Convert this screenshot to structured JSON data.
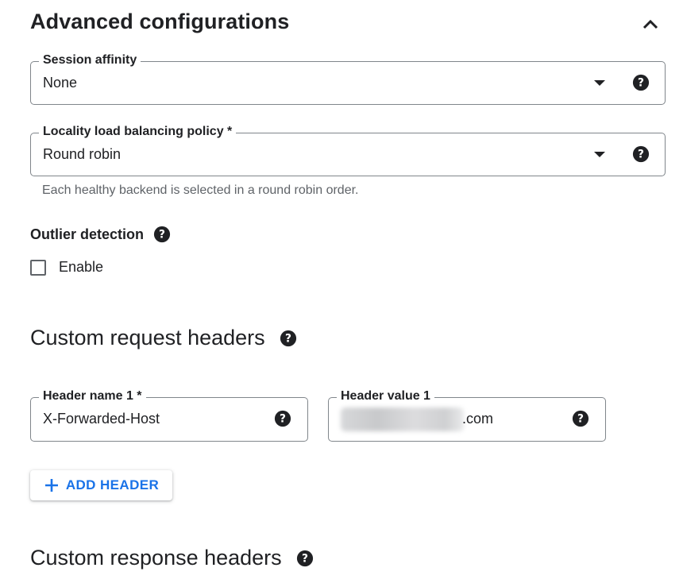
{
  "advanced": {
    "title": "Advanced configurations",
    "collapse_icon": "chevron-up-icon"
  },
  "session_affinity": {
    "label": "Session affinity",
    "value": "None"
  },
  "locality_policy": {
    "label": "Locality load balancing policy *",
    "value": "Round robin",
    "helper": "Each healthy backend is selected in a round robin order."
  },
  "outlier_detection": {
    "label": "Outlier detection",
    "checkbox_label": "Enable",
    "checked": false
  },
  "custom_request_headers": {
    "title": "Custom request headers",
    "header_name": {
      "label": "Header name 1 *",
      "value": "X-Forwarded-Host"
    },
    "header_value": {
      "label": "Header value 1",
      "value_suffix": ".com"
    },
    "add_button": {
      "label": "ADD HEADER",
      "icon": "plus-icon"
    }
  },
  "custom_response_headers": {
    "title": "Custom response headers"
  },
  "colors": {
    "accent": "#1a73e8",
    "text": "#202124",
    "secondary_text": "#5f6368",
    "border": "#80868b"
  }
}
